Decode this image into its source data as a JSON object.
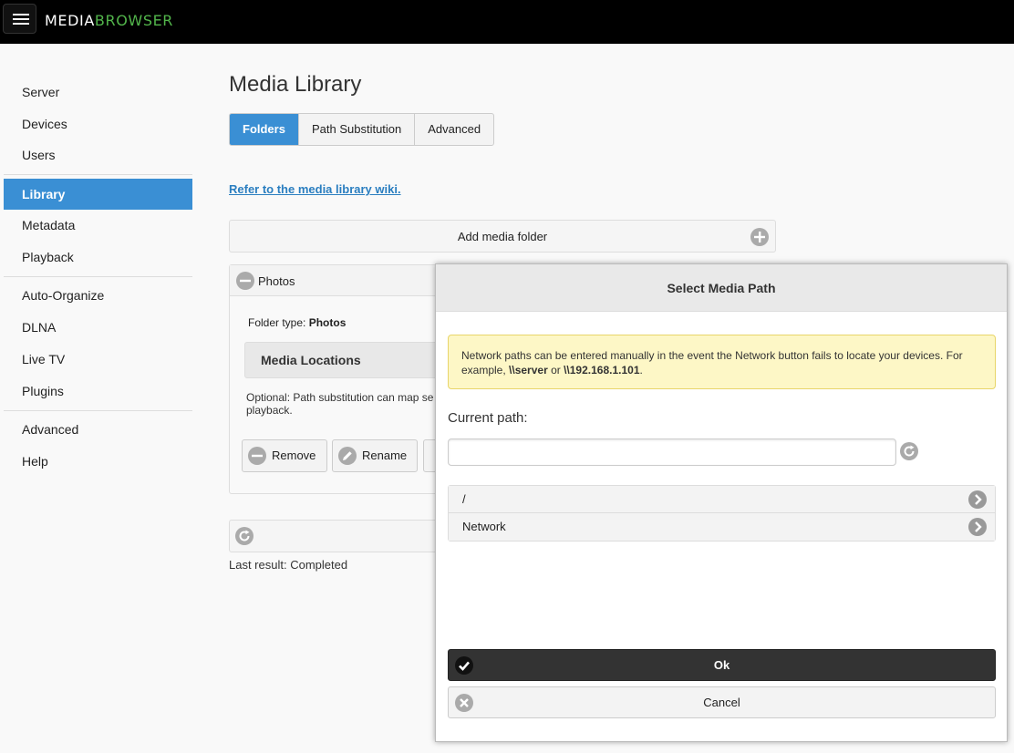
{
  "header": {
    "logo_primary": "MEDIA",
    "logo_accent": "BROWSER",
    "accent_color": "#52b54b"
  },
  "sidebar": {
    "items": [
      {
        "label": "Server"
      },
      {
        "label": "Devices"
      },
      {
        "label": "Users"
      },
      {
        "label": "Library",
        "active": true
      },
      {
        "label": "Metadata"
      },
      {
        "label": "Playback"
      },
      {
        "label": "Auto-Organize"
      },
      {
        "label": "DLNA"
      },
      {
        "label": "Live TV"
      },
      {
        "label": "Plugins"
      },
      {
        "label": "Advanced"
      },
      {
        "label": "Help"
      }
    ],
    "active_color": "#3a8fd4"
  },
  "main": {
    "title": "Media Library",
    "tabs": [
      {
        "label": "Folders",
        "active": true
      },
      {
        "label": "Path Substitution"
      },
      {
        "label": "Advanced"
      }
    ],
    "wiki_link": "Refer to the media library wiki.",
    "add_folder_label": "Add media folder",
    "folder": {
      "name": "Photos",
      "type_label": "Folder type:",
      "type_value": "Photos",
      "media_locations": "Media Locations",
      "optional_text": "Optional: Path substitution can map se playback.",
      "remove_label": "Remove",
      "rename_label": "Rename"
    },
    "last_result": "Last result: Completed"
  },
  "dialog": {
    "title": "Select Media Path",
    "notice_prefix": "Network paths can be entered manually in the event the Network button fails to locate your devices. For example, ",
    "notice_example1": "\\\\server",
    "notice_or": " or ",
    "notice_example2": "\\\\192.168.1.101",
    "notice_suffix": ".",
    "current_path_label": "Current path:",
    "current_path_value": "",
    "paths": [
      {
        "label": "/"
      },
      {
        "label": "Network"
      }
    ],
    "ok_label": "Ok",
    "cancel_label": "Cancel"
  },
  "icons": {
    "menu": "hamburger-icon",
    "add": "plus-circle-icon",
    "collapse": "minus-circle-icon",
    "edit": "pencil-icon",
    "refresh": "refresh-icon",
    "arrow": "chevron-right-circle-icon",
    "check": "check-icon",
    "cancel": "x-circle-icon"
  }
}
